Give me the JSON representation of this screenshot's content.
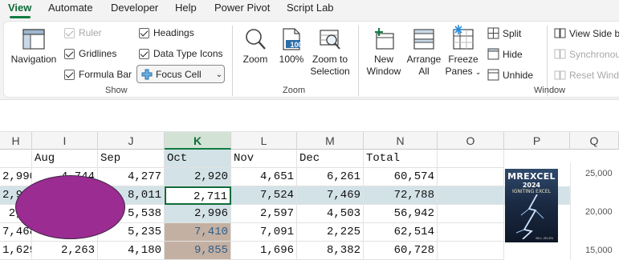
{
  "tabs": [
    "View",
    "Automate",
    "Developer",
    "Help",
    "Power Pivot",
    "Script Lab"
  ],
  "active_tab": "View",
  "ribbon": {
    "show": {
      "label": "Show",
      "navigation": "Navigation",
      "ruler": "Ruler",
      "gridlines": "Gridlines",
      "formula_bar": "Formula Bar",
      "headings": "Headings",
      "data_type_icons": "Data Type Icons",
      "focus_cell": "Focus Cell"
    },
    "zoom": {
      "label": "Zoom",
      "zoom": "Zoom",
      "hundred": "100%",
      "hundred_icon_text": "100",
      "zoom_to": "Zoom to",
      "selection": "Selection"
    },
    "window": {
      "label": "Window",
      "new": "New",
      "new2": "Window",
      "arrange": "Arrange",
      "arrange2": "All",
      "freeze": "Freeze",
      "freeze2": "Panes",
      "split": "Split",
      "hide": "Hide",
      "unhide": "Unhide",
      "view_side": "View Side b",
      "synchronous": "Synchronou",
      "reset_window": "Reset Wind"
    }
  },
  "grid": {
    "columns": [
      "H",
      "I",
      "J",
      "K",
      "L",
      "M",
      "N",
      "O",
      "P",
      "Q"
    ],
    "selected_column": "K",
    "header_row": [
      "",
      "Aug",
      "Sep",
      "Oct",
      "Nov",
      "Dec",
      "Total"
    ],
    "rows": [
      [
        "2,990",
        "4,744",
        "4,277",
        "2,920",
        "4,651",
        "6,261",
        "60,574"
      ],
      [
        "2,95",
        "",
        "8,011",
        "2,711",
        "7,524",
        "7,469",
        "72,788"
      ],
      [
        "2,6",
        "",
        "5,538",
        "2,996",
        "2,597",
        "4,503",
        "56,942"
      ],
      [
        "7,468",
        "",
        "5,235",
        "7,410",
        "7,091",
        "2,225",
        "62,514"
      ],
      [
        "1,629",
        "2,263",
        "4,180",
        "9,855",
        "1,696",
        "8,382",
        "60,728"
      ]
    ]
  },
  "book": {
    "title": "MREXCEL",
    "year": "2024",
    "subtitle": "IGNITING EXCEL",
    "author": "BILL JELEN"
  },
  "chart_axis": [
    "25,000",
    "20,000",
    "15,000"
  ],
  "colors": {
    "accent": "#107c41",
    "selection_fill": "#d3e2e7",
    "tan_fill": "#c4b0a2",
    "shape_fill": "#9a2c92"
  }
}
